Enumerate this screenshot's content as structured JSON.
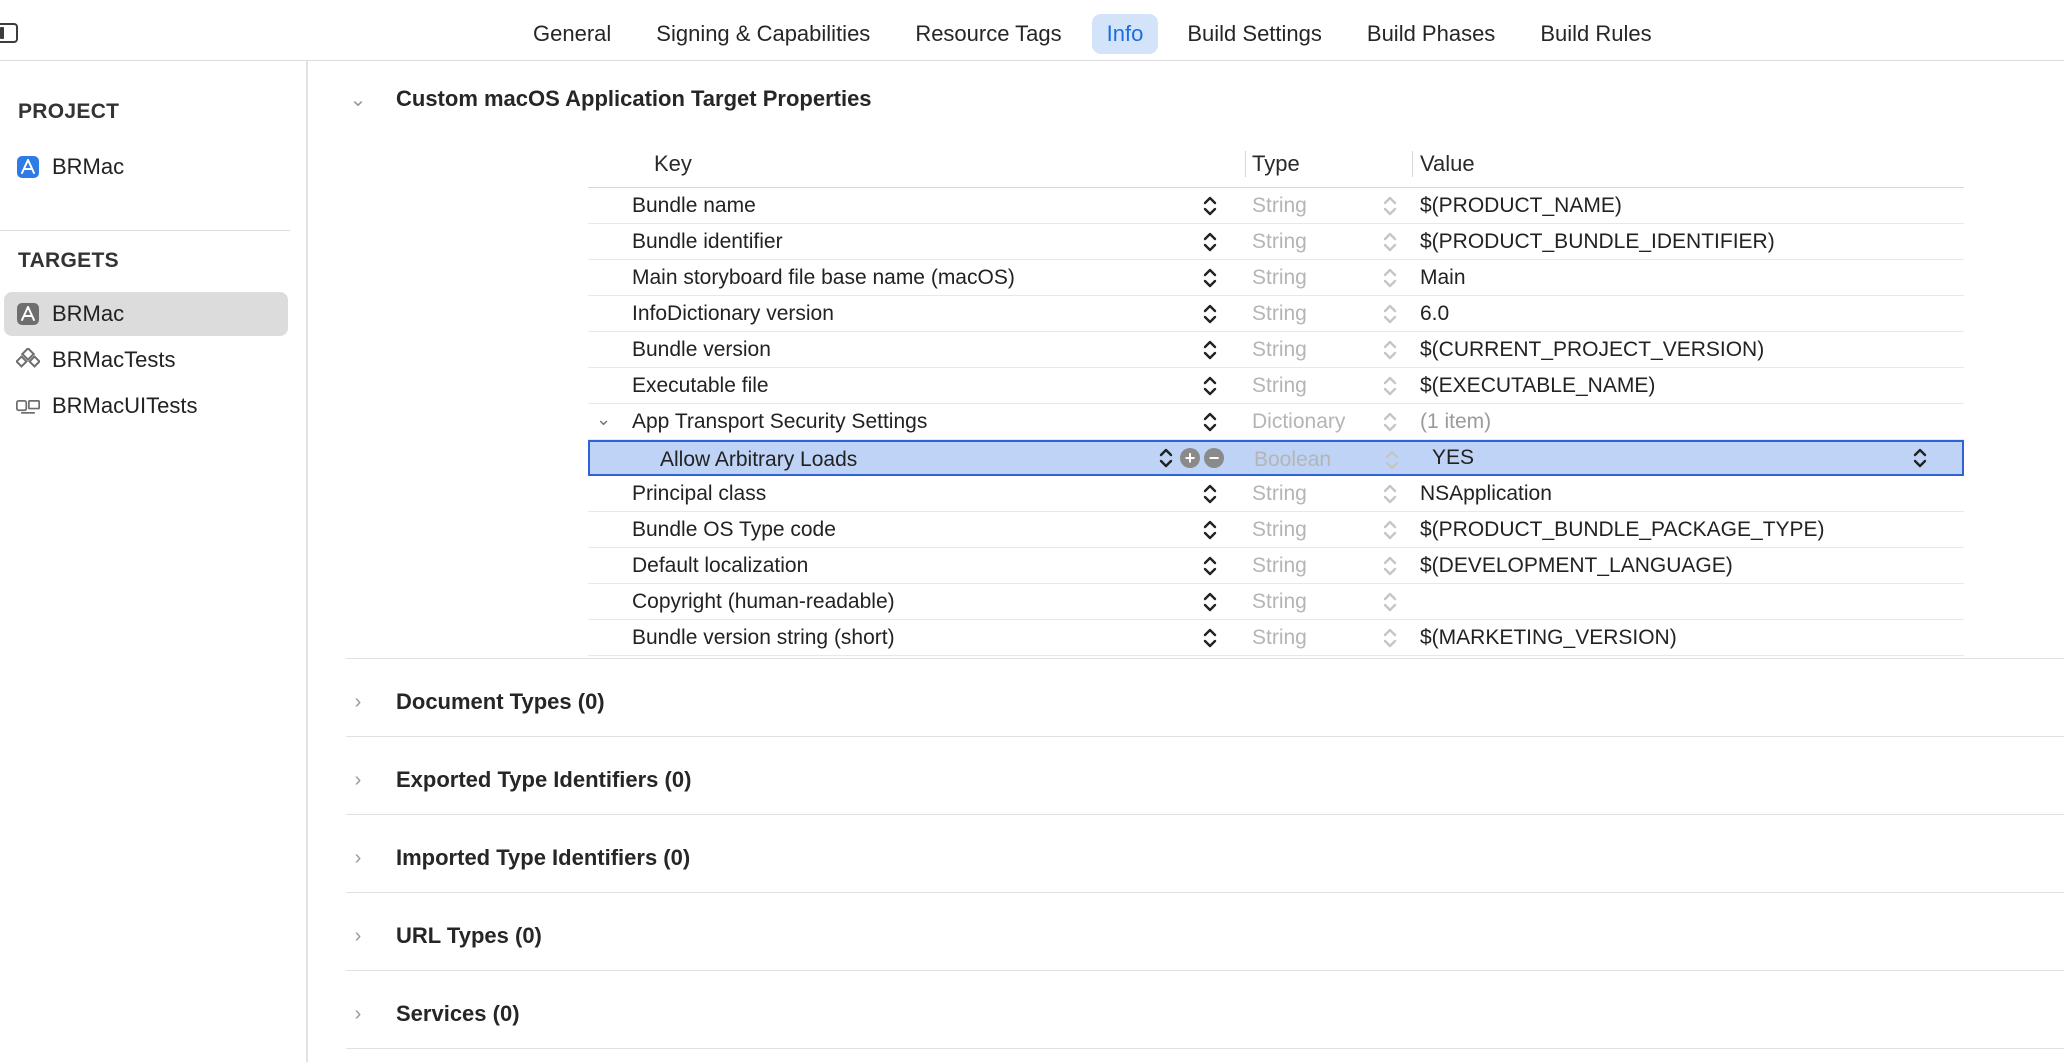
{
  "tabs": [
    {
      "label": "General"
    },
    {
      "label": "Signing & Capabilities"
    },
    {
      "label": "Resource Tags"
    },
    {
      "label": "Info",
      "active": true
    },
    {
      "label": "Build Settings"
    },
    {
      "label": "Build Phases"
    },
    {
      "label": "Build Rules"
    }
  ],
  "sidebar": {
    "project_header": "PROJECT",
    "project_items": [
      {
        "label": "BRMac",
        "icon": "app-icon"
      }
    ],
    "targets_header": "TARGETS",
    "target_items": [
      {
        "label": "BRMac",
        "icon": "app-target-icon",
        "selected": true
      },
      {
        "label": "BRMacTests",
        "icon": "unit-tests-icon"
      },
      {
        "label": "BRMacUITests",
        "icon": "ui-tests-icon"
      }
    ]
  },
  "main": {
    "properties_section": {
      "title": "Custom macOS Application Target Properties",
      "columns": {
        "key": "Key",
        "type": "Type",
        "value": "Value"
      },
      "rows": [
        {
          "key": "Bundle name",
          "type": "String",
          "value": "$(PRODUCT_NAME)"
        },
        {
          "key": "Bundle identifier",
          "type": "String",
          "value": "$(PRODUCT_BUNDLE_IDENTIFIER)"
        },
        {
          "key": "Main storyboard file base name (macOS)",
          "type": "String",
          "value": "Main"
        },
        {
          "key": "InfoDictionary version",
          "type": "String",
          "value": "6.0"
        },
        {
          "key": "Bundle version",
          "type": "String",
          "value": "$(CURRENT_PROJECT_VERSION)"
        },
        {
          "key": "Executable file",
          "type": "String",
          "value": "$(EXECUTABLE_NAME)"
        },
        {
          "key": "App Transport Security Settings",
          "type": "Dictionary",
          "value": "(1 item)",
          "expanded": true
        },
        {
          "key": "Allow Arbitrary Loads",
          "type": "Boolean",
          "value": "YES",
          "child": true,
          "selected": true
        },
        {
          "key": "Principal class",
          "type": "String",
          "value": "NSApplication"
        },
        {
          "key": "Bundle OS Type code",
          "type": "String",
          "value": "$(PRODUCT_BUNDLE_PACKAGE_TYPE)"
        },
        {
          "key": "Default localization",
          "type": "String",
          "value": "$(DEVELOPMENT_LANGUAGE)"
        },
        {
          "key": "Copyright (human-readable)",
          "type": "String",
          "value": ""
        },
        {
          "key": "Bundle version string (short)",
          "type": "String",
          "value": "$(MARKETING_VERSION)"
        }
      ]
    },
    "collapsed_sections": [
      {
        "title": "Document Types (0)"
      },
      {
        "title": "Exported Type Identifiers (0)"
      },
      {
        "title": "Imported Type Identifiers (0)"
      },
      {
        "title": "URL Types (0)"
      },
      {
        "title": "Services (0)"
      }
    ]
  },
  "colors": {
    "accent": "#1a6fe0",
    "selection": "#bed3f5",
    "selection_border": "#2e63d6"
  }
}
